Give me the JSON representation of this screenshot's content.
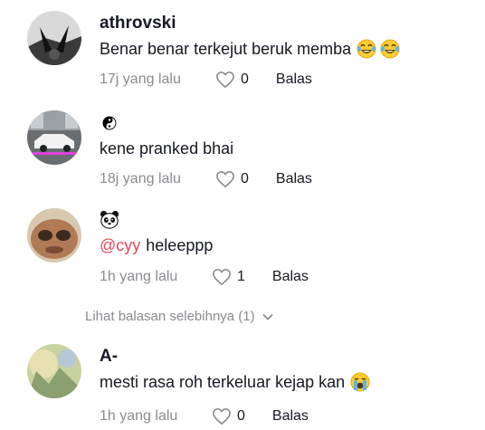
{
  "comments": [
    {
      "username": "athrovski",
      "username_emoji": "",
      "mention": "",
      "text": "Benar benar terkejut beruk memba",
      "trailing_emojis": [
        "face-with-tears-of-joy",
        "face-with-tears-of-joy"
      ],
      "time": "17j yang lalu",
      "likes": "0",
      "reply_label": "Balas"
    },
    {
      "username": "",
      "username_emoji": "yin-yang",
      "mention": "",
      "text": "kene pranked bhai",
      "trailing_emojis": [],
      "time": "18j yang lalu",
      "likes": "0",
      "reply_label": "Balas"
    },
    {
      "username": "",
      "username_emoji": "panda-face",
      "mention": "@cyy",
      "text": "heleeppp",
      "trailing_emojis": [],
      "time": "1h yang lalu",
      "likes": "1",
      "reply_label": "Balas"
    },
    {
      "username": "A-",
      "username_emoji": "",
      "mention": "",
      "text": "mesti rasa roh terkeluar kejap kan",
      "trailing_emojis": [
        "loudly-crying-face"
      ],
      "time": "1h yang lalu",
      "likes": "0",
      "reply_label": "Balas"
    }
  ],
  "view_more_replies": "Lihat balasan selebihnya (1)",
  "colors": {
    "mention": "#e2485a",
    "secondary_text": "#8a8b91",
    "primary_text": "#161823"
  }
}
